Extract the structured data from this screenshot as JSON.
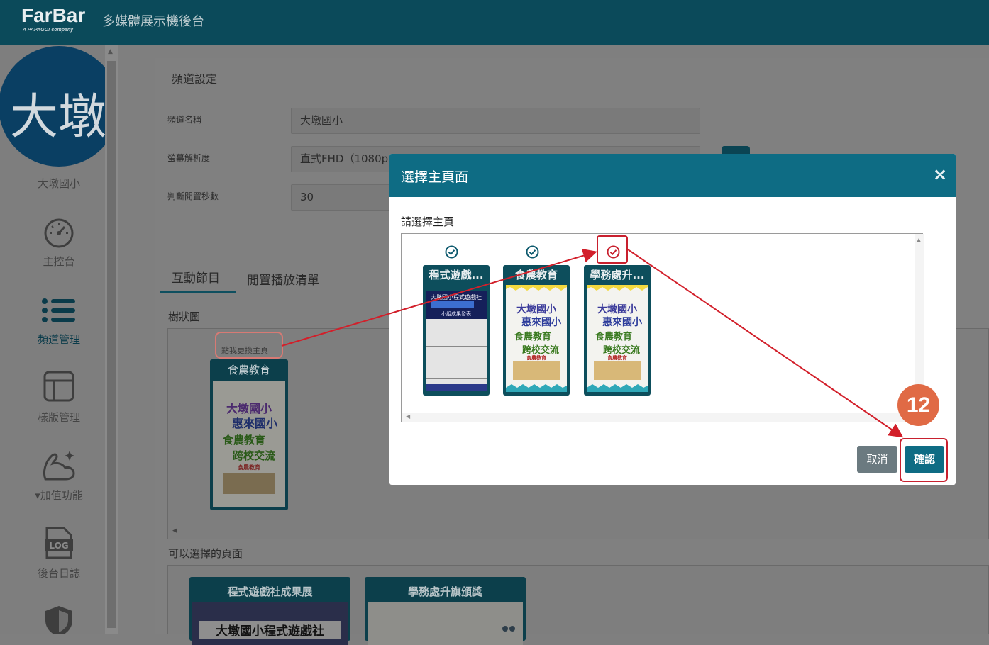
{
  "header": {
    "logo_main": "FarBar",
    "logo_sub": "A PAPAGO! company",
    "app_title": "多媒體展示機後台"
  },
  "sidebar": {
    "avatar_text": "大墩",
    "school_name": "大墩國小",
    "items": [
      {
        "label": "主控台",
        "icon": "dashboard-gauge-icon"
      },
      {
        "label": "頻道管理",
        "icon": "list-icon"
      },
      {
        "label": "樣版管理",
        "icon": "layout-template-icon"
      },
      {
        "label": "▾加值功能",
        "icon": "flexing-arm-sparkle-icon"
      },
      {
        "label": "後台日誌",
        "icon": "log-file-icon"
      },
      {
        "label": "",
        "icon": "shield-icon"
      }
    ]
  },
  "panel": {
    "heading": "頻道設定",
    "fields": [
      {
        "label": "頻道名稱",
        "value": "大墩國小"
      },
      {
        "label": "螢幕解析度",
        "value": "直式FHD（1080p"
      },
      {
        "label": "判斷閒置秒數",
        "value": "30"
      }
    ],
    "tabs": [
      "互動節目",
      "閒置播放清單"
    ],
    "tree_label": "樹狀圖",
    "hint": "點我更換主頁",
    "tree_card": {
      "title": "食農教育"
    },
    "available_label": "可以選擇的頁面",
    "available_cards": [
      {
        "title": "程式遊戲社成果展",
        "poster_text": "大墩國小程式遊戲社"
      },
      {
        "title": "學務處升旗頒獎"
      }
    ]
  },
  "poster_food": {
    "line1": "大墩國小",
    "line2": "惠來國小",
    "line3": "食農教育",
    "line4": "跨校交流",
    "line5": "食農教育"
  },
  "poster_game": {
    "line1": "大墩國小程式遊戲社",
    "line2": "小組成果發表"
  },
  "modal": {
    "title": "選擇主頁面",
    "close": "×",
    "label": "請選擇主頁",
    "options": [
      {
        "title": "程式遊戲...",
        "selected": false
      },
      {
        "title": "食農教育",
        "selected": false
      },
      {
        "title": "學務處升...",
        "selected": true
      }
    ],
    "cancel": "取消",
    "confirm": "確認"
  },
  "annotation": {
    "step": "12"
  },
  "colors": {
    "header": "#0b4a5a",
    "modal_header": "#0e6c84",
    "card": "#0d4e5c",
    "highlight_red": "#c8202e",
    "step_orange": "#e06a45"
  }
}
